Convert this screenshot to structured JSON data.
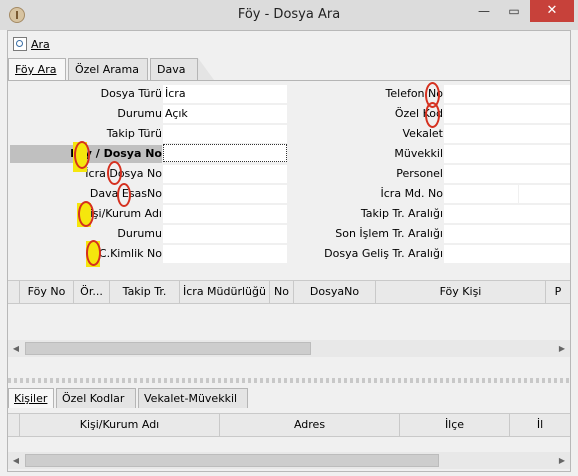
{
  "window": {
    "title": "Föy - Dosya Ara",
    "minimize": "—",
    "maximize": "▭",
    "close": "✕"
  },
  "toolbar": {
    "search_label": "Ara"
  },
  "tabs": [
    "Föy Ara",
    "Özel Arama",
    "Dava"
  ],
  "form_left": [
    {
      "label": "Dosya Türü",
      "value": "İcra"
    },
    {
      "label": "Durumu",
      "value": "Açık"
    },
    {
      "label": "Takip Türü",
      "value": ""
    },
    {
      "label": "Föy / Dosya No",
      "value": ""
    },
    {
      "label": "İcra Dosya No",
      "value": ""
    },
    {
      "label": "Dava EsasNo",
      "value": ""
    },
    {
      "label": "Kişi/Kurum Adı",
      "value": ""
    },
    {
      "label": "Durumu",
      "value": ""
    },
    {
      "label": "T.C.Kimlik No",
      "value": ""
    }
  ],
  "form_right": [
    {
      "label": "Telefon No",
      "value": ""
    },
    {
      "label": "Özel Kod",
      "value": ""
    },
    {
      "label": "Vekalet",
      "value": ""
    },
    {
      "label": "Müvekkil",
      "value": ""
    },
    {
      "label": "Personel",
      "value": ""
    },
    {
      "label": "İcra Md. No",
      "value": ""
    },
    {
      "label": "Takip Tr. Aralığı",
      "value": ""
    },
    {
      "label": "Son İşlem Tr. Aralığı",
      "value": ""
    },
    {
      "label": "Dosya Geliş Tr. Aralığı",
      "value": ""
    }
  ],
  "results_columns": [
    "Föy No",
    "Ör...",
    "Takip Tr.",
    "İcra Müdürlüğü",
    "No",
    "DosyaNo",
    "Föy Kişi",
    "P"
  ],
  "bottom_tabs": [
    "Kişiler",
    "Özel Kodlar",
    "Vekalet-Müvekkil"
  ],
  "bottom_columns": [
    "Kişi/Kurum Adı",
    "Adres",
    "İlçe",
    "İl"
  ],
  "scroll_left": "◀",
  "scroll_right": "▶",
  "colors": {
    "annotation_circle": "#d5301f",
    "annotation_highlight": "#f5e60d",
    "close_button": "#c7413a"
  }
}
